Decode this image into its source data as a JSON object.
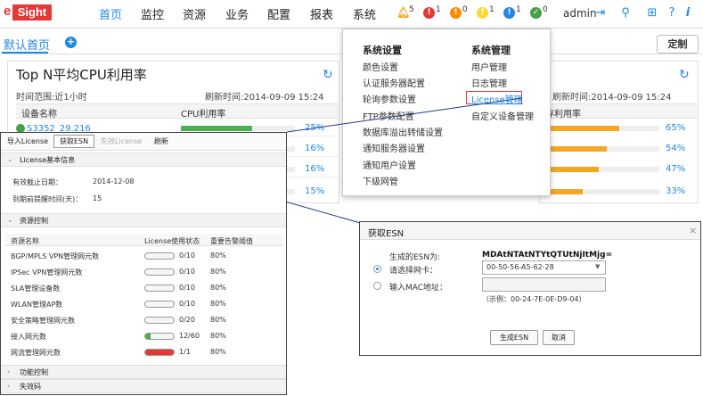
{
  "logo": {
    "prefix": "e",
    "word": "Sight"
  },
  "nav": {
    "items": [
      "首页",
      "监控",
      "资源",
      "业务",
      "配置",
      "报表",
      "系统"
    ],
    "active_index": 0
  },
  "alarms": [
    {
      "icon": "bell-icon",
      "count": "5",
      "color": "#f5a623"
    },
    {
      "icon": "critical-alarm-icon",
      "count": "1",
      "color": "#e53935"
    },
    {
      "icon": "major-alarm-icon",
      "count": "0",
      "color": "#fb8c00"
    },
    {
      "icon": "minor-alarm-icon",
      "count": "1",
      "color": "#fdd835"
    },
    {
      "icon": "warning-alarm-icon",
      "count": "1",
      "color": "#1e88e5"
    },
    {
      "icon": "info-alarm-icon",
      "count": "0",
      "color": "#43a047"
    }
  ],
  "user": {
    "name": "admin"
  },
  "tabs": {
    "home": "默认首页",
    "customize": "定制"
  },
  "widget_left": {
    "title": "Top N平均CPU利用率",
    "time_range": "时间范围:近1小时",
    "refresh_time": "刷新时间:2014-09-09 15:24",
    "col_device": "设备名称",
    "col_cpu": "CPU利用率",
    "first_device": "S3352_29.216",
    "rows": [
      {
        "pct": "25%",
        "value": 25
      },
      {
        "pct": "16%",
        "value": 16
      },
      {
        "pct": "16%",
        "value": 16
      },
      {
        "pct": "15%",
        "value": 15
      }
    ]
  },
  "widget_right": {
    "refresh_time": "刷新时间:2014-09-09 15:24",
    "col_partial": "存利用率",
    "rows": [
      {
        "pct": "65%",
        "value": 65
      },
      {
        "pct": "54%",
        "value": 54
      },
      {
        "pct": "47%",
        "value": 47
      },
      {
        "pct": "33%",
        "value": 33
      }
    ]
  },
  "system_menu": {
    "col1_title": "系统设置",
    "col1_items": [
      "颜色设置",
      "认证服务器配置",
      "轮询参数设置",
      "FTP参数配置",
      "数据库溢出转储设置",
      "通知服务器设置",
      "通知用户设置",
      "下级网管"
    ],
    "col2_title": "系统管理",
    "col2_items": [
      "用户管理",
      "日志管理",
      "License管理",
      "自定义设备管理"
    ]
  },
  "license_panel": {
    "toolbar": [
      "导入License",
      "获取ESN",
      "失效License",
      "刷新"
    ],
    "basic_section": "License基本信息",
    "expiry_label": "有效截止日期：",
    "expiry_value": "2014-12-08",
    "remind_label": "到期前提醒时间(天)：",
    "remind_value": "15",
    "resource_section": "资源控制",
    "res_headers": [
      "资源名称",
      "License使用状态",
      "重要告警阈值"
    ],
    "resources": [
      {
        "name": "BGP/MPLS VPN管理网元数",
        "used": "0/10",
        "ratio": 0,
        "color": "#4caf50",
        "threshold": "80%"
      },
      {
        "name": "IPSec VPN管理网元数",
        "used": "0/10",
        "ratio": 0,
        "color": "#4caf50",
        "threshold": "80%"
      },
      {
        "name": "SLA管理设备数",
        "used": "0/10",
        "ratio": 0,
        "color": "#4caf50",
        "threshold": "80%"
      },
      {
        "name": "WLAN管理AP数",
        "used": "0/10",
        "ratio": 0,
        "color": "#4caf50",
        "threshold": "80%"
      },
      {
        "name": "安全策略管理网元数",
        "used": "0/20",
        "ratio": 0,
        "color": "#4caf50",
        "threshold": "80%"
      },
      {
        "name": "接入网元数",
        "used": "12/60",
        "ratio": 0.2,
        "color": "#4caf50",
        "threshold": "80%"
      },
      {
        "name": "网流管理网元数",
        "used": "1/1",
        "ratio": 1,
        "color": "#e53935",
        "threshold": "80%"
      }
    ],
    "function_section": "功能控制",
    "invalid_section": "失效码"
  },
  "esn_dialog": {
    "title": "获取ESN",
    "generated_label": "生成的ESN为:",
    "esn": "MDAtNTAtNTYtQTUtNjItMjg=",
    "nic_label": "请选择网卡：",
    "nic_value": "00-50-56-A5-62-28",
    "mac_label": "输入MAC地址：",
    "mac_example": "（示例：00-24-7E-0E-D9-04）",
    "generate_btn": "生成ESN",
    "cancel_btn": "取消"
  }
}
